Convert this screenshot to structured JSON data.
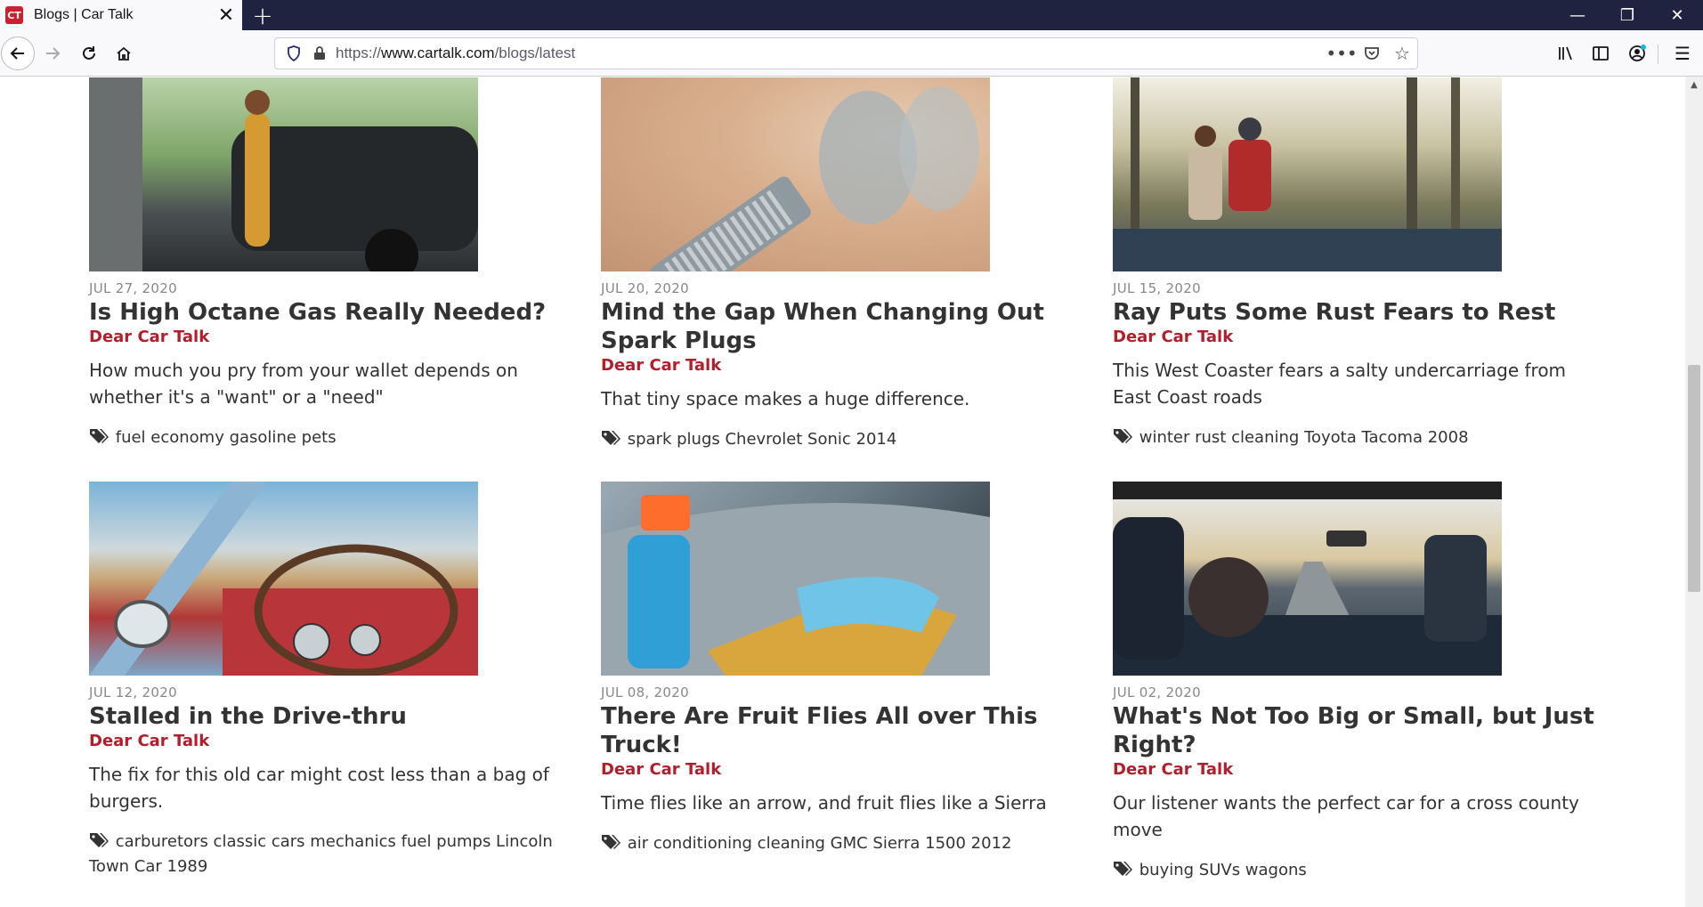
{
  "browser": {
    "tab_title": "Blogs | Car Talk",
    "favicon_text": "CT",
    "url_domain": "www.cartalk.com",
    "url_prefix": "https://",
    "url_path": "/blogs/latest",
    "colors": {
      "tabbar": "#202340",
      "toolbar": "#f9f9fb"
    }
  },
  "posts": [
    {
      "date": "JUL 27, 2020",
      "title": "Is High Octane Gas Really Needed?",
      "category": "Dear Car Talk",
      "description": "How much you pry from your wallet depends on whether it's a \"want\" or a \"need\"",
      "tags": "fuel economy gasoline pets"
    },
    {
      "date": "JUL 20, 2020",
      "title": "Mind the Gap When Changing Out Spark Plugs",
      "category": "Dear Car Talk",
      "description": "That tiny space makes a huge difference.",
      "tags": "spark plugs Chevrolet Sonic 2014"
    },
    {
      "date": "JUL 15, 2020",
      "title": "Ray Puts Some Rust Fears to Rest",
      "category": "Dear Car Talk",
      "description": "This West Coaster fears a salty undercarriage from East Coast roads",
      "tags": "winter rust cleaning Toyota Tacoma 2008"
    },
    {
      "date": "JUL 12, 2020",
      "title": "Stalled in the Drive-thru",
      "category": "Dear Car Talk",
      "description": "The fix for this old car might cost less than a bag of burgers.",
      "tags": "carburetors classic cars mechanics fuel pumps Lincoln Town Car 1989"
    },
    {
      "date": "JUL 08, 2020",
      "title": "There Are Fruit Flies All over This Truck!",
      "category": "Dear Car Talk",
      "description": "Time flies like an arrow, and fruit flies like a Sierra",
      "tags": "air conditioning cleaning GMC Sierra 1500 2012"
    },
    {
      "date": "JUL 02, 2020",
      "title": "What's Not Too Big or Small, but Just Right?",
      "category": "Dear Car Talk",
      "description": "Our listener wants the perfect car for a cross county move",
      "tags": "buying SUVs wagons"
    }
  ],
  "accent_color": "#b21e2b"
}
